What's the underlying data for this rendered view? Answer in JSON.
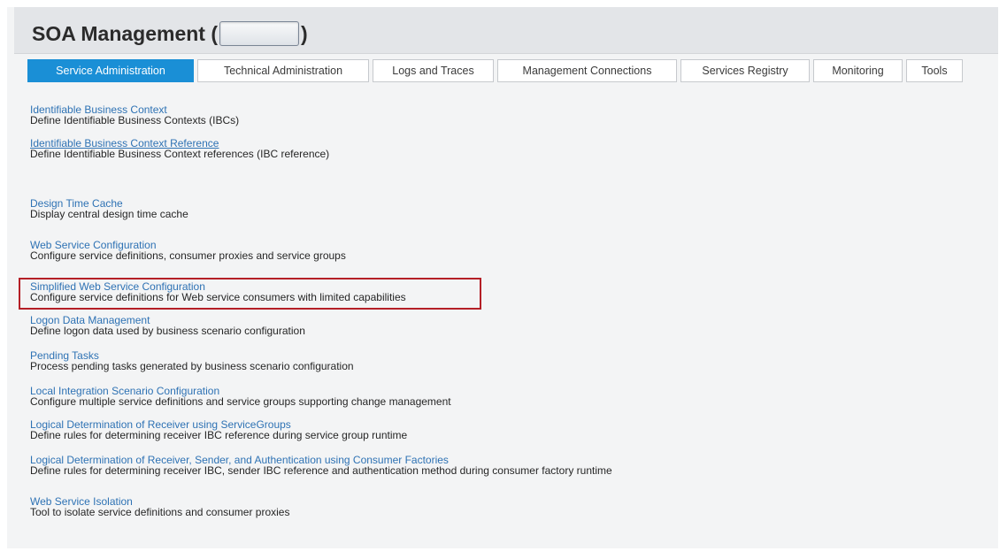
{
  "header": {
    "title_prefix": "SOA Management (",
    "title_suffix": ")"
  },
  "tabs": [
    {
      "label": "Service Administration",
      "active": true
    },
    {
      "label": "Technical Administration",
      "active": false
    },
    {
      "label": "Logs and Traces",
      "active": false
    },
    {
      "label": "Management Connections",
      "active": false
    },
    {
      "label": "Services Registry",
      "active": false
    },
    {
      "label": "Monitoring",
      "active": false
    },
    {
      "label": "Tools",
      "active": false
    }
  ],
  "entries": [
    {
      "link": "Identifiable Business Context",
      "desc": "Define Identifiable Business Contexts (IBCs)"
    },
    {
      "link": "Identifiable Business Context Reference",
      "desc": "Define Identifiable Business Context references (IBC reference)"
    },
    {
      "link": "Design Time Cache",
      "desc": "Display central design time cache"
    },
    {
      "link": "Web Service Configuration",
      "desc": "Configure service definitions, consumer proxies and service groups"
    },
    {
      "link": "Simplified Web Service Configuration",
      "desc": "Configure service definitions for Web service consumers with limited capabilities"
    },
    {
      "link": "Logon Data Management",
      "desc": "Define logon data used by business scenario configuration"
    },
    {
      "link": "Pending Tasks",
      "desc": "Process pending tasks generated by business scenario configuration"
    },
    {
      "link": "Local Integration Scenario Configuration",
      "desc": "Configure multiple service definitions and service groups supporting change management"
    },
    {
      "link": "Logical Determination of Receiver using ServiceGroups",
      "desc": "Define rules for determining receiver IBC reference during service group runtime"
    },
    {
      "link": "Logical Determination of Receiver, Sender, and Authentication using Consumer Factories",
      "desc": "Define rules for determining receiver IBC, sender IBC reference and authentication method during consumer factory runtime"
    },
    {
      "link": "Web Service Isolation",
      "desc": "Tool to isolate service definitions and consumer proxies"
    }
  ],
  "colors": {
    "active_tab": "#1a8fd6",
    "link": "#2e72b4",
    "highlight_border": "#b41f26"
  }
}
